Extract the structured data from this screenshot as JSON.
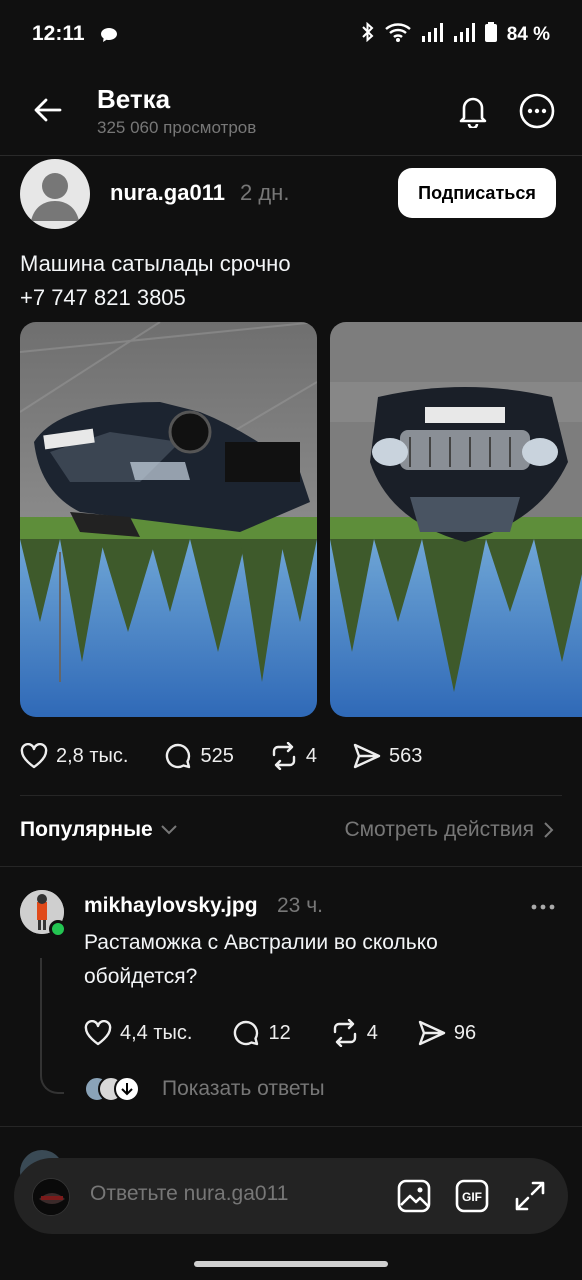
{
  "status_bar": {
    "time": "12:11",
    "battery": "84 %"
  },
  "header": {
    "title": "Ветка",
    "subtitle": "325 060 просмотров"
  },
  "post": {
    "username": "nura.ga011",
    "time": "2 дн.",
    "follow_label": "Подписаться",
    "text_line1": "Машина сатылады срочно",
    "text_line2": "+7 747 821 3805",
    "photos": [
      "car-photo-upside-down-side",
      "car-photo-upside-down-front"
    ],
    "stats": {
      "likes": "2,8 тыс.",
      "comments": "525",
      "reposts": "4",
      "shares": "563"
    }
  },
  "filter": {
    "sort_label": "Популярные",
    "activity_label": "Смотреть действия"
  },
  "comment": {
    "username": "mikhaylovsky.jpg",
    "time": "23 ч.",
    "text": "Растаможка с Австралии во сколько обойдется?",
    "stats": {
      "likes": "4,4 тыс.",
      "comments": "12",
      "reposts": "4",
      "shares": "96"
    },
    "show_replies_label": "Показать ответы"
  },
  "composer": {
    "placeholder": "Ответьте nura.ga011"
  },
  "colors": {
    "background": "#101010",
    "muted_text": "#777777",
    "online": "#23c552"
  }
}
